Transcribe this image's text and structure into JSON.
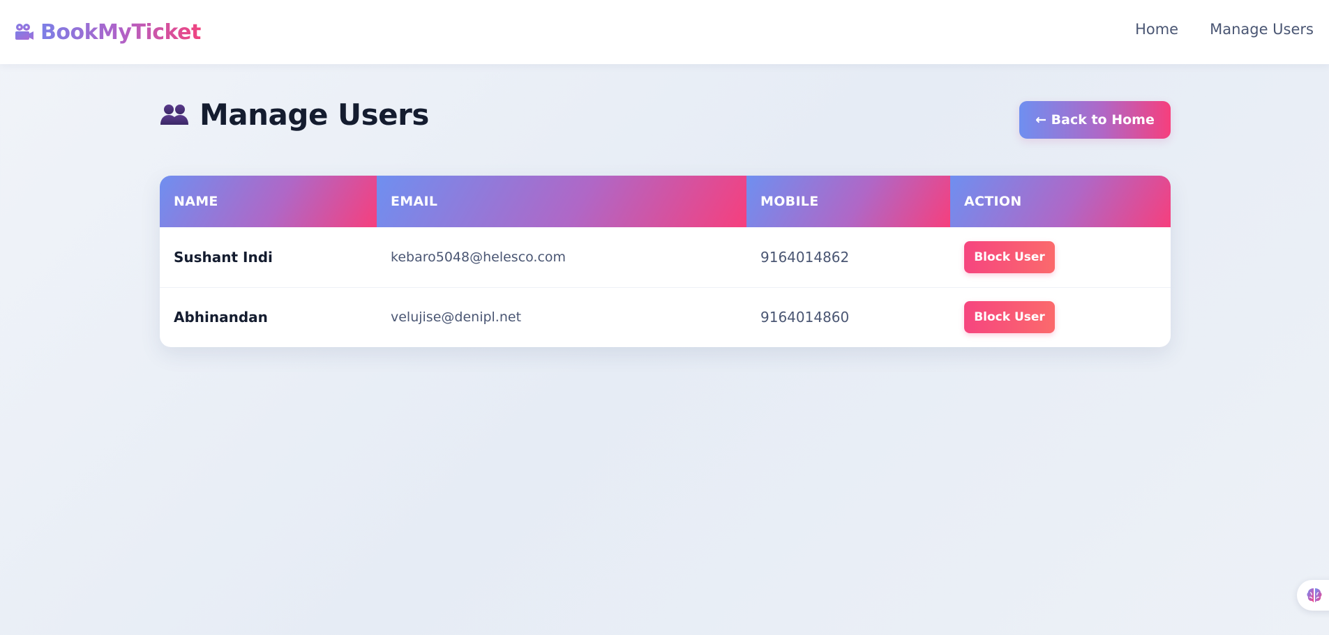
{
  "navbar": {
    "brand_icon": "movie-camera-icon",
    "brand_name": "BookMyTicket",
    "links": [
      {
        "label": "Home"
      },
      {
        "label": "Manage Users"
      }
    ]
  },
  "page": {
    "title_icon": "users-icon",
    "title": "Manage Users",
    "back_button_label": "← Back to Home"
  },
  "table": {
    "columns": [
      "NAME",
      "EMAIL",
      "MOBILE",
      "ACTION"
    ],
    "rows": [
      {
        "name": "Sushant Indi",
        "email": "kebaro5048@helesco.com",
        "mobile": "9164014862",
        "action": "Block User"
      },
      {
        "name": "Abhinandan",
        "email": "velujise@denipl.net",
        "mobile": "9164014860",
        "action": "Block User"
      }
    ]
  },
  "widget": {
    "icon": "brain-icon"
  },
  "colors": {
    "accent_start": "#6f8ff0",
    "accent_mid": "#b067c6",
    "accent_end": "#f63f7d",
    "danger": "#f6457f",
    "text_dark": "#141c2f",
    "text_muted": "#4a5673"
  }
}
